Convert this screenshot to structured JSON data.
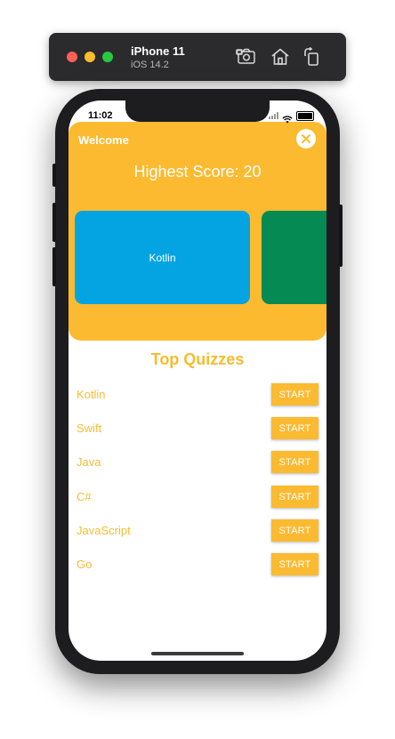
{
  "simulator": {
    "device_name": "iPhone 11",
    "os_version": "iOS 14.2",
    "tools": [
      "screenshot-icon",
      "home-icon",
      "rotate-icon"
    ]
  },
  "status_bar": {
    "time": "11:02"
  },
  "header": {
    "welcome": "Welcome",
    "highest_score": "Highest Score: 20",
    "cards": [
      {
        "label": "Kotlin",
        "color": "#04a4e2"
      },
      {
        "label": "",
        "color": "#048a52"
      }
    ],
    "background": "#fbba30"
  },
  "top_quizzes": {
    "title": "Top Quizzes",
    "items": [
      {
        "name": "Kotlin",
        "button": "START"
      },
      {
        "name": "Swift",
        "button": "START"
      },
      {
        "name": "Java",
        "button": "START"
      },
      {
        "name": "C#",
        "button": "START"
      },
      {
        "name": "JavaScript",
        "button": "START"
      },
      {
        "name": "Go",
        "button": "START"
      }
    ]
  },
  "colors": {
    "accent": "#fbba30",
    "quiz_text": "#f7bd35",
    "card_blue": "#04a4e2",
    "card_green": "#048a52"
  }
}
